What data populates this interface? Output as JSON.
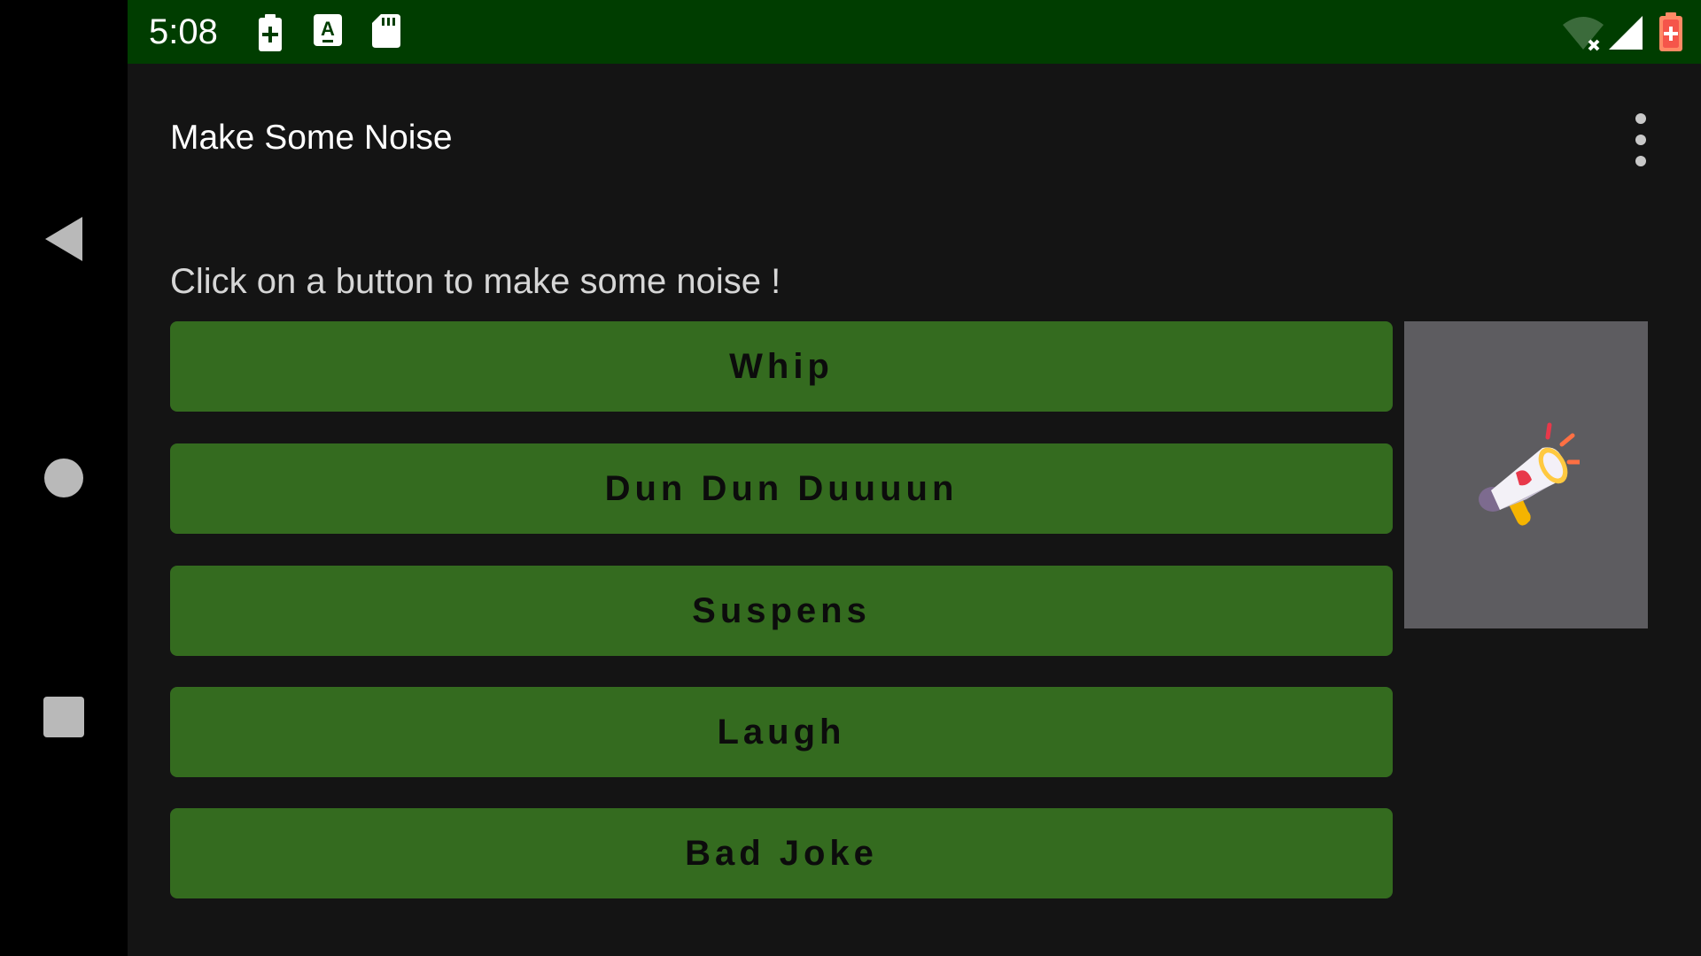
{
  "status_bar": {
    "time": "5:08",
    "left_icons": [
      "battery-saver-icon",
      "keyboard-a-icon",
      "sd-card-icon"
    ],
    "right_icons": [
      "wifi-off-icon",
      "cell-signal-icon",
      "battery-low-icon"
    ]
  },
  "app_bar": {
    "title": "Make Some Noise",
    "menu_icon": "overflow-menu-icon"
  },
  "main": {
    "instruction": "Click on a button to make some noise !",
    "buttons": [
      {
        "label": "Whip"
      },
      {
        "label": "Dun Dun Duuuun"
      },
      {
        "label": "Suspens"
      },
      {
        "label": "Laugh"
      },
      {
        "label": "Bad Joke"
      }
    ],
    "image_icon": "megaphone-icon"
  },
  "navigation": {
    "icons": [
      "back-icon",
      "home-icon",
      "recents-icon"
    ]
  },
  "colors": {
    "status_bar": "#003d00",
    "background": "#141414",
    "button": "#346b1f",
    "button_text": "#0c0c0c",
    "image_panel": "#5d5c60"
  }
}
